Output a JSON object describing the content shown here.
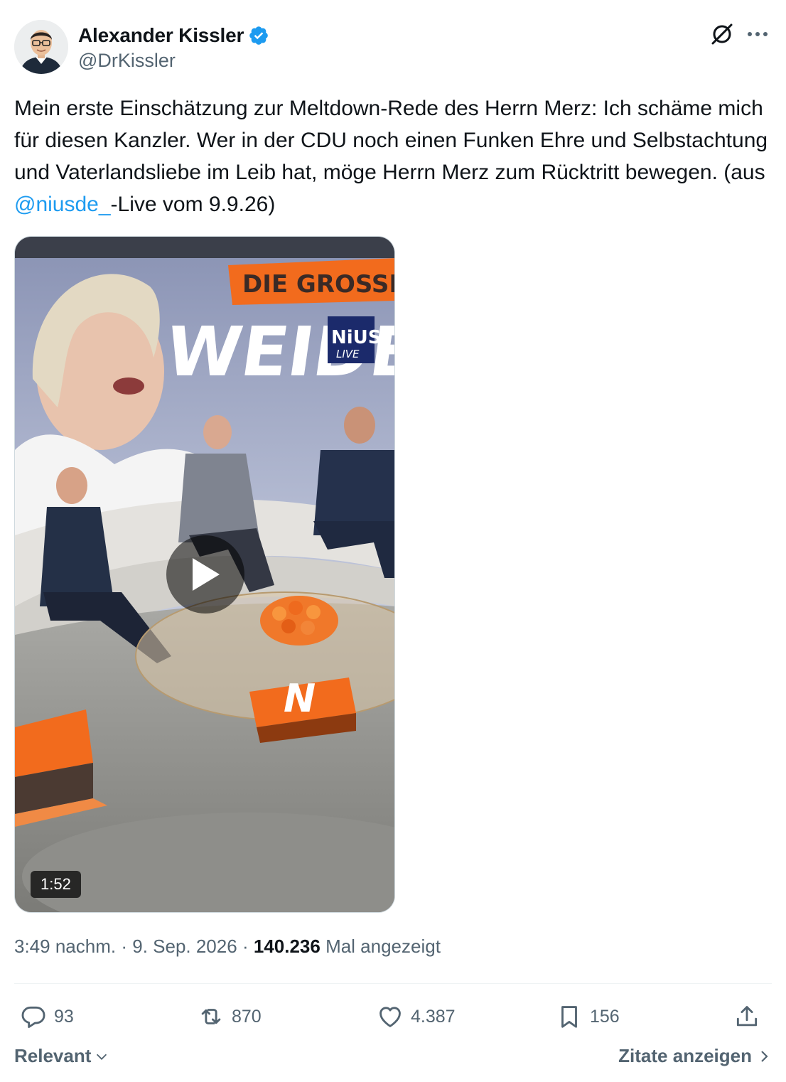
{
  "author": {
    "display_name": "Alexander Kissler",
    "handle": "@DrKissler",
    "verified": true
  },
  "tweet": {
    "text_before": "Mein erste Einschätzung zur Meltdown-Rede des Herrn Merz: Ich schäme mich für diesen Kanzler. Wer in der CDU noch einen Funken Ehre und Selbstachtung und Vaterlandsliebe im Leib hat, möge Herrn Merz zum Rücktritt bewegen. (aus ",
    "mention": "@niusde_",
    "text_after": "-Live vom 9.9.26)"
  },
  "video": {
    "duration": "1:52",
    "banner_top": "DIE GROSSE",
    "banner_main": "WEIDEL",
    "logo_top": "NiUS",
    "logo_bottom": "LIVE",
    "floor_logo": "N"
  },
  "meta": {
    "time": "3:49 nachm.",
    "separator": "·",
    "date": "9. Sep. 2026",
    "views_count": "140.236",
    "views_label": "Mal angezeigt"
  },
  "actions": {
    "replies": "93",
    "reposts": "870",
    "likes": "4.387",
    "bookmarks": "156"
  },
  "footer": {
    "sort_label": "Relevant",
    "quotes_label": "Zitate anzeigen"
  },
  "colors": {
    "accent": "#1d9bf0",
    "text": "#0f1419",
    "muted": "#536471",
    "nius_orange": "#f26b1d",
    "nius_navy": "#1b2a6b"
  }
}
